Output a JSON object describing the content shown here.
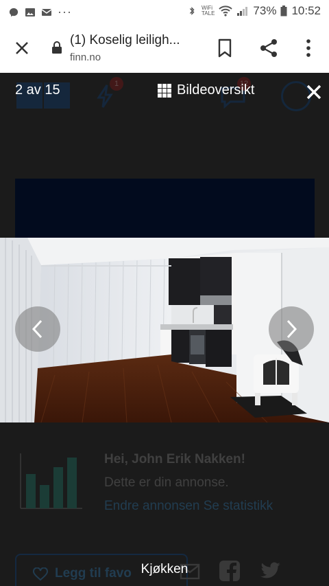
{
  "statusbar": {
    "battery": "73%",
    "time": "10:52",
    "wifi_top": "WiFi",
    "wifi_bottom": "TALE"
  },
  "browser": {
    "tab_title": "(1) Koselig leiligh...",
    "domain": "finn.no"
  },
  "background_nav": {
    "badge_one": "1",
    "badge_two": "12"
  },
  "gallery": {
    "counter": "2 av 15",
    "overview_label": "Bildeoversikt",
    "caption": "Kjøkken"
  },
  "background_info": {
    "greeting": "Hei, John Erik Nakken!",
    "subtitle": "Dette er din annonse.",
    "links": "Endre annonsen Se statistikk",
    "favorite_label": "Legg til favo"
  },
  "colors": {
    "overlay": "#1b1b1b",
    "brand_blue": "#0a3f7a",
    "banner": "#020b1e"
  }
}
